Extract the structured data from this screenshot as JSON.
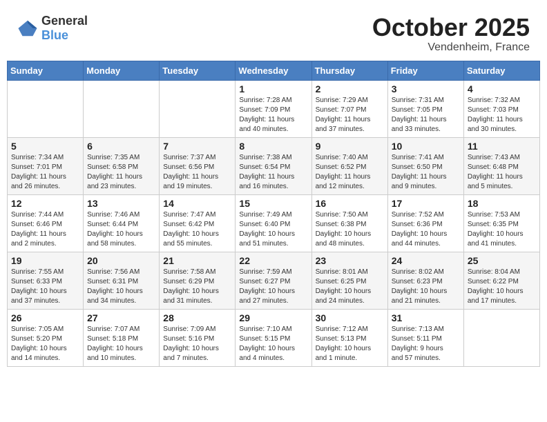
{
  "header": {
    "logo": {
      "text_general": "General",
      "text_blue": "Blue"
    },
    "month": "October 2025",
    "location": "Vendenheim, France"
  },
  "weekdays": [
    "Sunday",
    "Monday",
    "Tuesday",
    "Wednesday",
    "Thursday",
    "Friday",
    "Saturday"
  ],
  "weeks": [
    [
      {
        "day": "",
        "info": ""
      },
      {
        "day": "",
        "info": ""
      },
      {
        "day": "",
        "info": ""
      },
      {
        "day": "1",
        "info": "Sunrise: 7:28 AM\nSunset: 7:09 PM\nDaylight: 11 hours\nand 40 minutes."
      },
      {
        "day": "2",
        "info": "Sunrise: 7:29 AM\nSunset: 7:07 PM\nDaylight: 11 hours\nand 37 minutes."
      },
      {
        "day": "3",
        "info": "Sunrise: 7:31 AM\nSunset: 7:05 PM\nDaylight: 11 hours\nand 33 minutes."
      },
      {
        "day": "4",
        "info": "Sunrise: 7:32 AM\nSunset: 7:03 PM\nDaylight: 11 hours\nand 30 minutes."
      }
    ],
    [
      {
        "day": "5",
        "info": "Sunrise: 7:34 AM\nSunset: 7:01 PM\nDaylight: 11 hours\nand 26 minutes."
      },
      {
        "day": "6",
        "info": "Sunrise: 7:35 AM\nSunset: 6:58 PM\nDaylight: 11 hours\nand 23 minutes."
      },
      {
        "day": "7",
        "info": "Sunrise: 7:37 AM\nSunset: 6:56 PM\nDaylight: 11 hours\nand 19 minutes."
      },
      {
        "day": "8",
        "info": "Sunrise: 7:38 AM\nSunset: 6:54 PM\nDaylight: 11 hours\nand 16 minutes."
      },
      {
        "day": "9",
        "info": "Sunrise: 7:40 AM\nSunset: 6:52 PM\nDaylight: 11 hours\nand 12 minutes."
      },
      {
        "day": "10",
        "info": "Sunrise: 7:41 AM\nSunset: 6:50 PM\nDaylight: 11 hours\nand 9 minutes."
      },
      {
        "day": "11",
        "info": "Sunrise: 7:43 AM\nSunset: 6:48 PM\nDaylight: 11 hours\nand 5 minutes."
      }
    ],
    [
      {
        "day": "12",
        "info": "Sunrise: 7:44 AM\nSunset: 6:46 PM\nDaylight: 11 hours\nand 2 minutes."
      },
      {
        "day": "13",
        "info": "Sunrise: 7:46 AM\nSunset: 6:44 PM\nDaylight: 10 hours\nand 58 minutes."
      },
      {
        "day": "14",
        "info": "Sunrise: 7:47 AM\nSunset: 6:42 PM\nDaylight: 10 hours\nand 55 minutes."
      },
      {
        "day": "15",
        "info": "Sunrise: 7:49 AM\nSunset: 6:40 PM\nDaylight: 10 hours\nand 51 minutes."
      },
      {
        "day": "16",
        "info": "Sunrise: 7:50 AM\nSunset: 6:38 PM\nDaylight: 10 hours\nand 48 minutes."
      },
      {
        "day": "17",
        "info": "Sunrise: 7:52 AM\nSunset: 6:36 PM\nDaylight: 10 hours\nand 44 minutes."
      },
      {
        "day": "18",
        "info": "Sunrise: 7:53 AM\nSunset: 6:35 PM\nDaylight: 10 hours\nand 41 minutes."
      }
    ],
    [
      {
        "day": "19",
        "info": "Sunrise: 7:55 AM\nSunset: 6:33 PM\nDaylight: 10 hours\nand 37 minutes."
      },
      {
        "day": "20",
        "info": "Sunrise: 7:56 AM\nSunset: 6:31 PM\nDaylight: 10 hours\nand 34 minutes."
      },
      {
        "day": "21",
        "info": "Sunrise: 7:58 AM\nSunset: 6:29 PM\nDaylight: 10 hours\nand 31 minutes."
      },
      {
        "day": "22",
        "info": "Sunrise: 7:59 AM\nSunset: 6:27 PM\nDaylight: 10 hours\nand 27 minutes."
      },
      {
        "day": "23",
        "info": "Sunrise: 8:01 AM\nSunset: 6:25 PM\nDaylight: 10 hours\nand 24 minutes."
      },
      {
        "day": "24",
        "info": "Sunrise: 8:02 AM\nSunset: 6:23 PM\nDaylight: 10 hours\nand 21 minutes."
      },
      {
        "day": "25",
        "info": "Sunrise: 8:04 AM\nSunset: 6:22 PM\nDaylight: 10 hours\nand 17 minutes."
      }
    ],
    [
      {
        "day": "26",
        "info": "Sunrise: 7:05 AM\nSunset: 5:20 PM\nDaylight: 10 hours\nand 14 minutes."
      },
      {
        "day": "27",
        "info": "Sunrise: 7:07 AM\nSunset: 5:18 PM\nDaylight: 10 hours\nand 10 minutes."
      },
      {
        "day": "28",
        "info": "Sunrise: 7:09 AM\nSunset: 5:16 PM\nDaylight: 10 hours\nand 7 minutes."
      },
      {
        "day": "29",
        "info": "Sunrise: 7:10 AM\nSunset: 5:15 PM\nDaylight: 10 hours\nand 4 minutes."
      },
      {
        "day": "30",
        "info": "Sunrise: 7:12 AM\nSunset: 5:13 PM\nDaylight: 10 hours\nand 1 minute."
      },
      {
        "day": "31",
        "info": "Sunrise: 7:13 AM\nSunset: 5:11 PM\nDaylight: 9 hours\nand 57 minutes."
      },
      {
        "day": "",
        "info": ""
      }
    ]
  ]
}
